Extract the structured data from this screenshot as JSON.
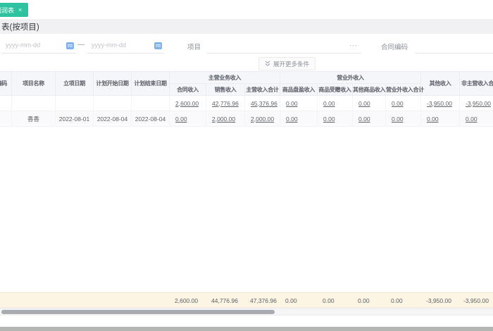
{
  "tab_bar": {
    "active_tab": {
      "label": "利润表",
      "close_icon": "×"
    }
  },
  "page": {
    "title": "表(按项目)"
  },
  "filters": {
    "date_start": {
      "placeholder": "yyyy-mm-dd"
    },
    "separator": "—",
    "date_end": {
      "placeholder": "yyyy-mm-dd"
    },
    "project": {
      "label": "项目",
      "suffix": "···"
    },
    "contract_code": {
      "label": "合同编码",
      "suffix": "···"
    },
    "expand_more_label": "展开更多条件"
  },
  "table": {
    "headers": {
      "project_code": "编码",
      "project_name": "项目名称",
      "filing_date": "立项日期",
      "plan_start_date": "计划开始日期",
      "plan_end_date": "计划结束日期",
      "main_business_income_group": "主营业务收入",
      "contract_income": "合同收入",
      "sales_income": "销售收入",
      "main_income_total": "主营收入合计",
      "non_operating_income_group": "营业外收入",
      "goods_surplus_income": "商品盘盈收入",
      "goods_donated_income": "商品受赠收入",
      "other_goods_income": "其他商品收入",
      "non_operating_income_total": "营业外收入合计",
      "other_income": "其他收入",
      "non_main_income_total": "非主营收入合计"
    },
    "rows": [
      {
        "contract_income": "2,600.00",
        "sales_income": "42,776.96",
        "main_income_total": "45,376.96",
        "goods_surplus_income": "0.00",
        "goods_donated_income": "0.00",
        "other_goods_income": "0.00",
        "non_operating_income_total": "0.00",
        "other_income": "-3,950.00",
        "non_main_income_total": "-3,950.00"
      },
      {
        "project_name": "香香",
        "filing_date": "2022-08-01",
        "plan_start_date": "2022-08-04",
        "plan_end_date": "2022-08-04",
        "contract_income": "0.00",
        "sales_income": "2,000.00",
        "main_income_total": "2,000.00",
        "goods_surplus_income": "0.00",
        "goods_donated_income": "0.00",
        "other_goods_income": "0.00",
        "non_operating_income_total": "0.00",
        "other_income": "0.00",
        "non_main_income_total": "0.00"
      }
    ],
    "summary_row": {
      "contract_income": "2,600.00",
      "sales_income": "44,776.96",
      "main_income_total": "47,376.96",
      "goods_surplus_income": "0.00",
      "goods_donated_income": "0.00",
      "other_goods_income": "0.00",
      "non_operating_income_total": "0.00",
      "other_income": "-3,950.00",
      "non_main_income_total": "-3,950.00"
    }
  },
  "colors": {
    "tab_accent": "#2ec2a0",
    "negative_value": "#f25b5b",
    "summary_background": "#fcf5e4",
    "header_background": "#f5f6fa",
    "calendar_icon_blue": "#7fb2ec"
  }
}
